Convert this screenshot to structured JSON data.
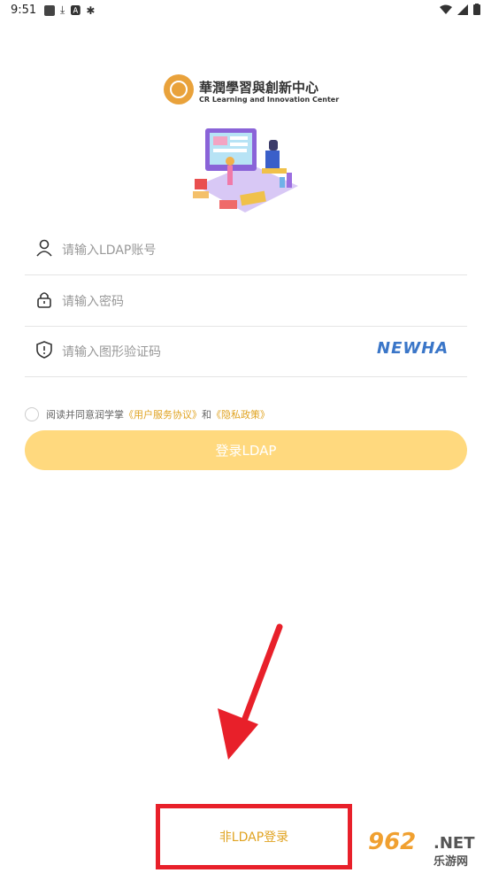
{
  "status_bar": {
    "time": "9:51"
  },
  "logo": {
    "chinese_name": "華潤學習與創新中心",
    "english_name": "CR Learning and Innovation Center"
  },
  "form": {
    "username_placeholder": "请输入LDAP账号",
    "password_placeholder": "请输入密码",
    "captcha_placeholder": "请输入图形验证码",
    "captcha_text": "NEWHA"
  },
  "agreement": {
    "prefix": "阅读并同意润学掌",
    "user_agreement": "《用户服务协议》",
    "and": "和",
    "privacy_policy": "《隐私政策》"
  },
  "buttons": {
    "login_ldap": "登录LDAP",
    "non_ldap_login": "非LDAP登录"
  },
  "watermark": {
    "number": "962",
    "net": ".NET",
    "site_cn": "乐游网"
  },
  "colors": {
    "accent": "#e0a321",
    "button_bg": "#ffd97e",
    "annotation_red": "#e8202a"
  }
}
